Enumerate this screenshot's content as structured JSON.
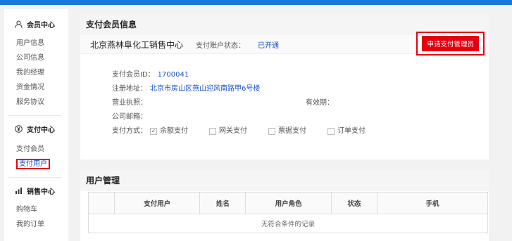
{
  "sidebar": {
    "member": {
      "title": "会员中心",
      "items": [
        "用户信息",
        "公司信息",
        "我的经理",
        "资金情况",
        "服务协议"
      ]
    },
    "pay": {
      "title": "支付中心",
      "items": [
        "支付会员",
        "支付用户"
      ]
    },
    "sales": {
      "title": "销售中心",
      "items": [
        "购物车",
        "我的订单"
      ]
    }
  },
  "pay_info": {
    "title": "支付会员信息",
    "company_name": "北京燕林阜化工销售中心",
    "status_label": "支付账户状态：",
    "status_value": "已开通",
    "apply_button": "申请支付管理员",
    "member_id_label": "支付会员ID：",
    "member_id": "1700041",
    "address_label": "注册地址：",
    "address": "北京市房山区燕山迎风南路甲6号楼",
    "license_label": "营业执照：",
    "validity_label": "有效期：",
    "email_label": "公司邮箱：",
    "pay_method_label": "支付方式：",
    "methods": [
      "余额支付",
      "网关支付",
      "票据支付",
      "订单支付"
    ]
  },
  "user_mgmt": {
    "title": "用户管理",
    "columns": [
      "支付用户",
      "姓名",
      "用户角色",
      "状态",
      "手机"
    ],
    "empty_text": "无符合条件的记录"
  }
}
